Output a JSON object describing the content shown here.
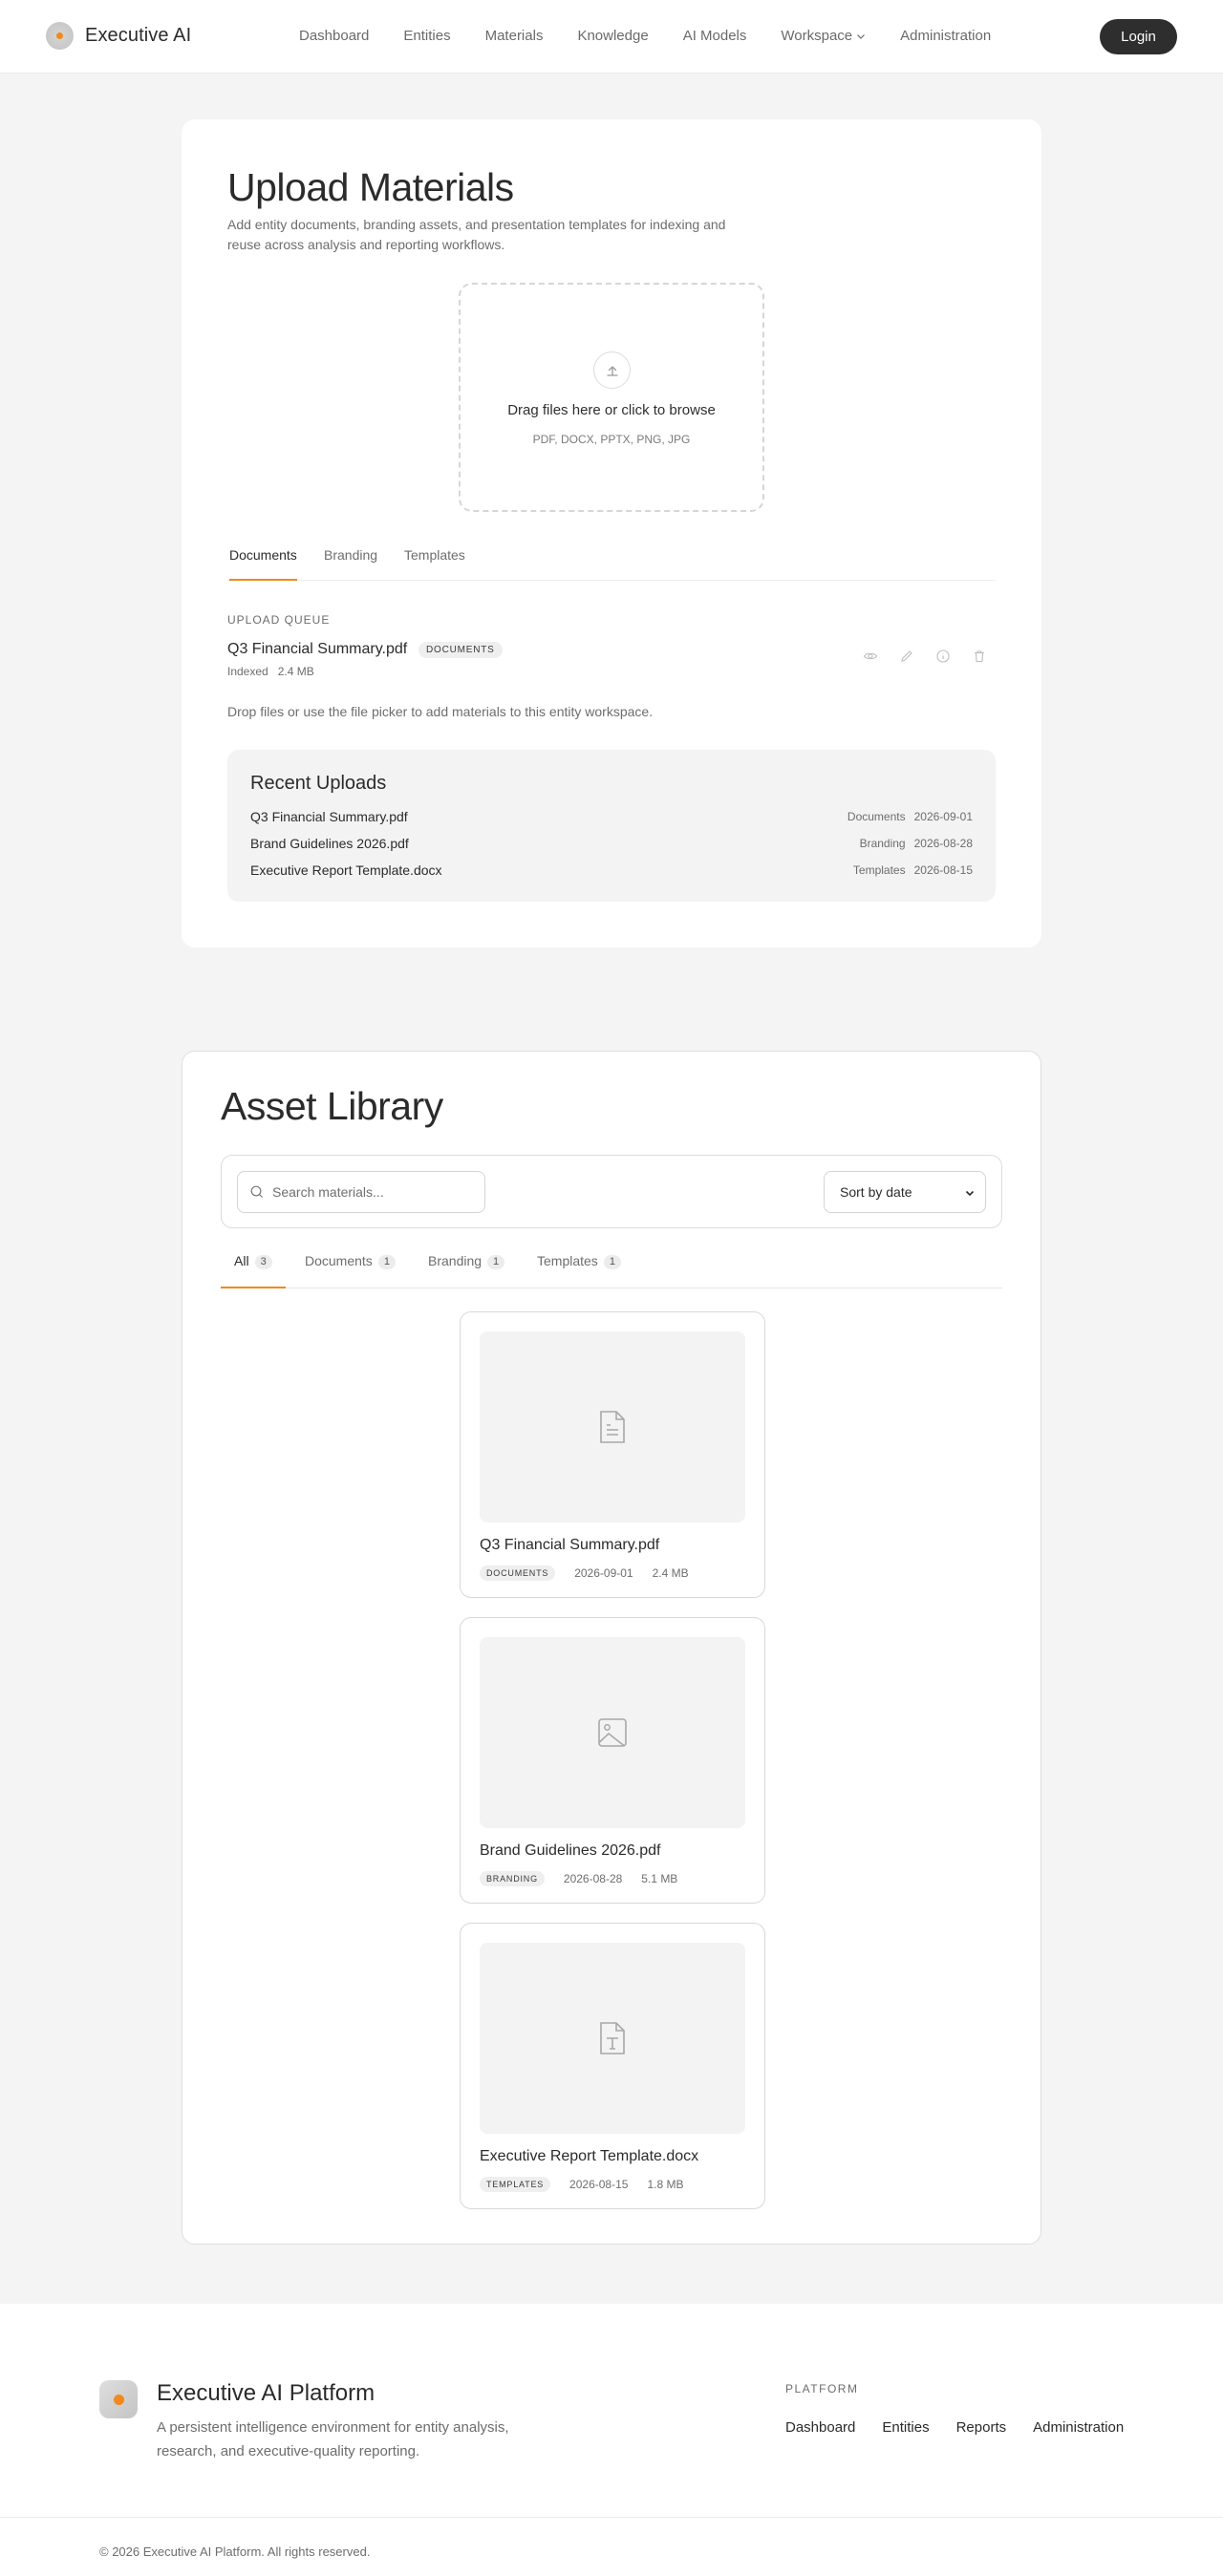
{
  "header": {
    "brand": "Executive AI",
    "nav": [
      "Dashboard",
      "Entities",
      "Materials",
      "Knowledge",
      "AI Models",
      "Workspace",
      "Administration"
    ],
    "login_label": "Login"
  },
  "upload": {
    "title": "Upload Materials",
    "subtitle": "Add entity documents, branding assets, and presentation templates for indexing and reuse across analysis and reporting workflows.",
    "dropzone": {
      "icon": "upload-icon",
      "title": "Drag files here or click to browse",
      "hint": "PDF, DOCX, PPTX, PNG, JPG"
    },
    "tabs": [
      "Documents",
      "Branding",
      "Templates"
    ],
    "active_tab": "Documents",
    "queue_label": "UPLOAD QUEUE",
    "queue": [
      {
        "name": "Q3 Financial Summary.pdf",
        "badge": "DOCUMENTS",
        "status": "Indexed",
        "size": "2.4 MB"
      }
    ],
    "queue_actions": [
      "eye-icon",
      "pencil-icon",
      "info-icon",
      "trash-icon"
    ],
    "note": "Drop files or use the file picker to add materials to this entity workspace.",
    "recent_title": "Recent Uploads",
    "recent": [
      {
        "name": "Q3 Financial Summary.pdf",
        "category": "Documents",
        "date": "2026-09-01"
      },
      {
        "name": "Brand Guidelines 2026.pdf",
        "category": "Branding",
        "date": "2026-08-28"
      },
      {
        "name": "Executive Report Template.docx",
        "category": "Templates",
        "date": "2026-08-15"
      }
    ]
  },
  "library": {
    "title": "Asset Library",
    "search_placeholder": "Search materials...",
    "sort_label": "Sort by date",
    "tabs": [
      {
        "label": "All",
        "count": "3"
      },
      {
        "label": "Documents",
        "count": "1"
      },
      {
        "label": "Branding",
        "count": "1"
      },
      {
        "label": "Templates",
        "count": "1"
      }
    ],
    "assets": [
      {
        "name": "Q3 Financial Summary.pdf",
        "badge": "DOCUMENTS",
        "date": "2026-09-01",
        "size": "2.4 MB",
        "icon": "document-icon"
      },
      {
        "name": "Brand Guidelines 2026.pdf",
        "badge": "BRANDING",
        "date": "2026-08-28",
        "size": "5.1 MB",
        "icon": "image-icon"
      },
      {
        "name": "Executive Report Template.docx",
        "badge": "TEMPLATES",
        "date": "2026-08-15",
        "size": "1.8 MB",
        "icon": "template-icon"
      }
    ]
  },
  "footer": {
    "title": "Executive AI Platform",
    "description": "A persistent intelligence environment for entity analysis, research, and executive-quality reporting.",
    "platform_label": "PLATFORM",
    "links": [
      "Dashboard",
      "Entities",
      "Reports",
      "Administration"
    ],
    "copyright": "© 2026 Executive AI Platform. All rights reserved."
  },
  "colors": {
    "accent": "#f08a1c",
    "button_dark": "#2e2e2e",
    "background": "#f4f4f4"
  }
}
